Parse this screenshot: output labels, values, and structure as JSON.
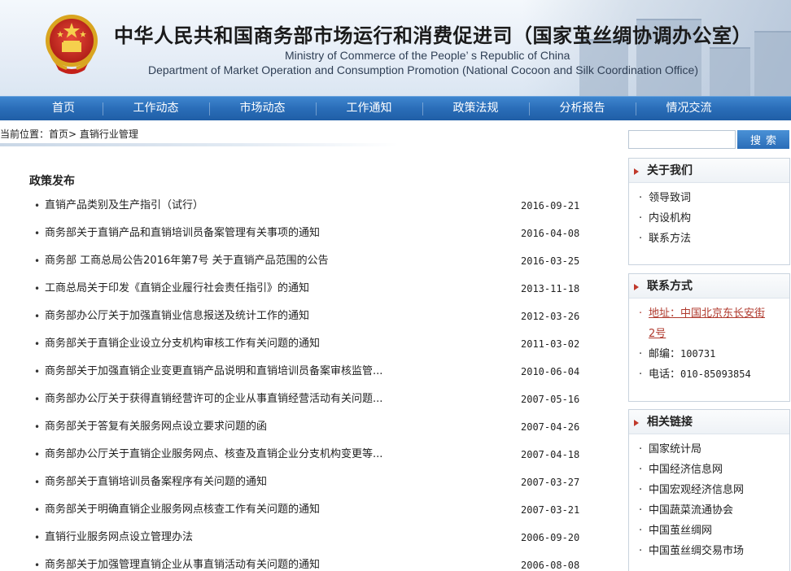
{
  "header": {
    "title_cn": "中华人民共和国商务部市场运行和消费促进司（国家茧丝绸协调办公室）",
    "title_en_1": "Ministry of Commerce of the People’ s Republic of China",
    "title_en_2": "Department of Market Operation and Consumption Promotion (National Cocoon and Silk Coordination Office)"
  },
  "nav": {
    "items": [
      "首页",
      "工作动态",
      "市场动态",
      "工作通知",
      "政策法规",
      "分析报告",
      "情况交流"
    ]
  },
  "breadcrumb": {
    "text": "当前位置：首页> 直销行业管理"
  },
  "main": {
    "section_title": "政策发布",
    "articles": [
      {
        "title": "直销产品类别及生产指引（试行）",
        "date": "2016-09-21"
      },
      {
        "title": "商务部关于直销产品和直销培训员备案管理有关事项的通知",
        "date": "2016-04-08"
      },
      {
        "title": "商务部 工商总局公告2016年第7号  关于直销产品范围的公告",
        "date": "2016-03-25"
      },
      {
        "title": "工商总局关于印发《直销企业履行社会责任指引》的通知",
        "date": "2013-11-18"
      },
      {
        "title": "商务部办公厅关于加强直销业信息报送及统计工作的通知",
        "date": "2012-03-26"
      },
      {
        "title": "商务部关于直销企业设立分支机构审核工作有关问题的通知",
        "date": "2011-03-02"
      },
      {
        "title": "商务部关于加强直销企业变更直销产品说明和直销培训员备案审核监管...",
        "date": "2010-06-04"
      },
      {
        "title": "商务部办公厅关于获得直销经营许可的企业从事直销经营活动有关问题...",
        "date": "2007-05-16"
      },
      {
        "title": "商务部关于答复有关服务网点设立要求问题的函",
        "date": "2007-04-26"
      },
      {
        "title": "商务部办公厅关于直销企业服务网点、核查及直销企业分支机构变更等...",
        "date": "2007-04-18"
      },
      {
        "title": "商务部关于直销培训员备案程序有关问题的通知",
        "date": "2007-03-27"
      },
      {
        "title": "商务部关于明确直销企业服务网点核查工作有关问题的通知",
        "date": "2007-03-21"
      },
      {
        "title": "直销行业服务网点设立管理办法",
        "date": "2006-09-20"
      },
      {
        "title": "商务部关于加强管理直销企业从事直销活动有关问题的通知",
        "date": "2006-08-08"
      }
    ]
  },
  "sidebar": {
    "search": {
      "placeholder": "",
      "button_label": "搜索"
    },
    "about": {
      "title": "关于我们",
      "items": [
        "领导致词",
        "内设机构",
        "联系方法"
      ]
    },
    "contact": {
      "title": "联系方式",
      "address_line1": "地址：中国北京东长安街",
      "address_line2": "2号",
      "postcode_label": "邮编：",
      "postcode": "100731",
      "phone_label": "电话：",
      "phone": "010-85093854"
    },
    "links": {
      "title": "相关链接",
      "items": [
        "国家统计局",
        "中国经济信息网",
        "中国宏观经济信息网",
        "中国蔬菜流通协会",
        "中国茧丝绸网",
        "中国茧丝绸交易市场"
      ]
    }
  },
  "colors": {
    "nav_bg": "#2a6db8",
    "accent_red": "#c0392b",
    "link_red": "#b03a2e"
  }
}
